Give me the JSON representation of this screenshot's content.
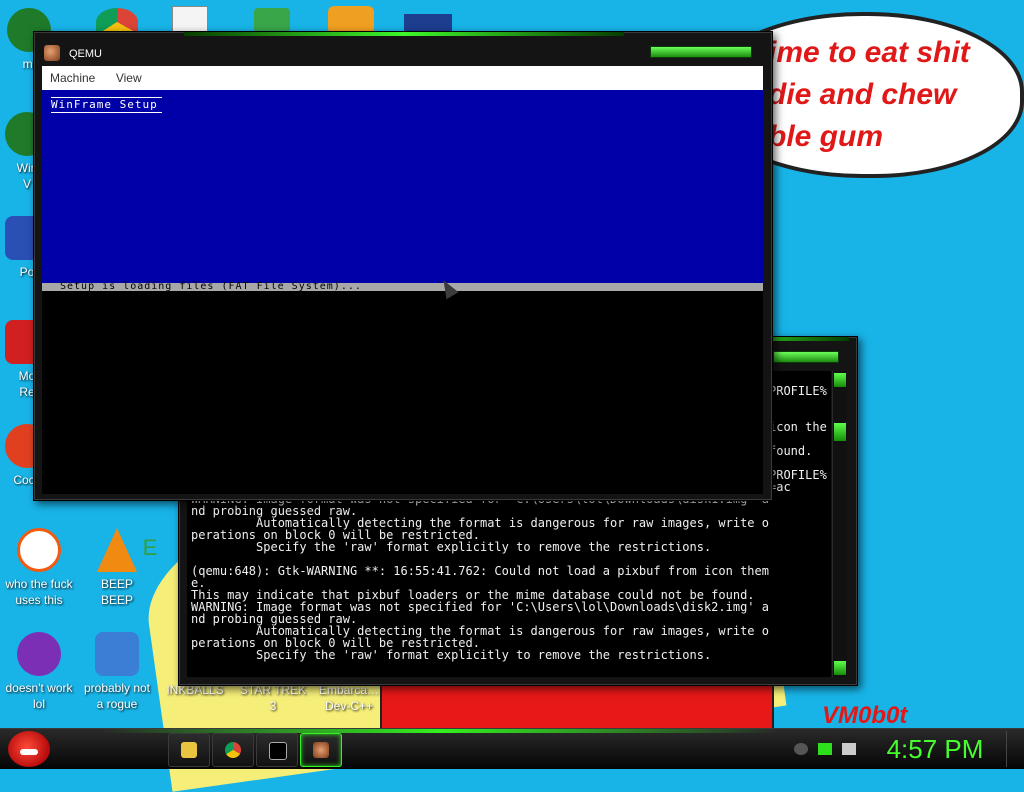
{
  "wallpaper": {
    "bubble_text": "ime to eat shit\ndie and chew\nble gum",
    "signature": "VM0b0t"
  },
  "desktop_icons": [
    {
      "label": "mi",
      "color": "#1f7a2a"
    },
    {
      "label": "Win\nV",
      "color": "#1f7a2a"
    },
    {
      "label": "Po",
      "color": "#2a4fb5"
    },
    {
      "label": "Mo\nRe",
      "color": "#d22020"
    },
    {
      "label": "Cock",
      "color": "#e04020"
    },
    {
      "label": "who the fuck\nuses this",
      "color": "#f25a10"
    },
    {
      "label": "BEEP\nBEEP",
      "color": "#f08a10"
    },
    {
      "label": "doesn't work\nlol",
      "color": "#7a2fb5"
    },
    {
      "label": "probably not\na rogue",
      "color": "#3a7fd5"
    },
    {
      "label": "INKBALLS",
      "color": "#e0e0e0"
    },
    {
      "label": "STAR TREK\n3",
      "color": "#e0e0e0"
    },
    {
      "label": "Embarca…\nDev-C++",
      "color": "#e0e0e0"
    },
    {
      "label": "E",
      "color": "#30a040"
    }
  ],
  "top_icons": [
    "chrome-icon",
    "cards-icon",
    "shield-icon",
    "game-icon",
    "flag-icon"
  ],
  "qemu": {
    "title": "QEMU",
    "menu": [
      "Machine",
      "View"
    ],
    "screen_title": "WinFrame Setup",
    "status_text": "Setup is loading files (FAT File System)..."
  },
  "console": {
    "partial_right": [
      "PROFILE%",
      "icon the",
      "found.",
      "PROFILE%",
      "=ac"
    ],
    "lines": [
      "WARNING: Image format was not specified for 'C:\\Users\\lol\\Downloads\\disk1.img' a",
      "nd probing guessed raw.",
      "         Automatically detecting the format is dangerous for raw images, write o",
      "perations on block 0 will be restricted.",
      "         Specify the 'raw' format explicitly to remove the restrictions.",
      "",
      "(qemu:648): Gtk-WARNING **: 16:55:41.762: Could not load a pixbuf from icon them",
      "e.",
      "This may indicate that pixbuf loaders or the mime database could not be found.",
      "WARNING: Image format was not specified for 'C:\\Users\\lol\\Downloads\\disk2.img' a",
      "nd probing guessed raw.",
      "         Automatically detecting the format is dangerous for raw images, write o",
      "perations on block 0 will be restricted.",
      "         Specify the 'raw' format explicitly to remove the restrictions."
    ]
  },
  "taskbar": {
    "buttons": [
      "explorer",
      "chrome",
      "cmd",
      "qemu"
    ],
    "clock": "4:57 PM",
    "accent": "#3ef82a"
  }
}
